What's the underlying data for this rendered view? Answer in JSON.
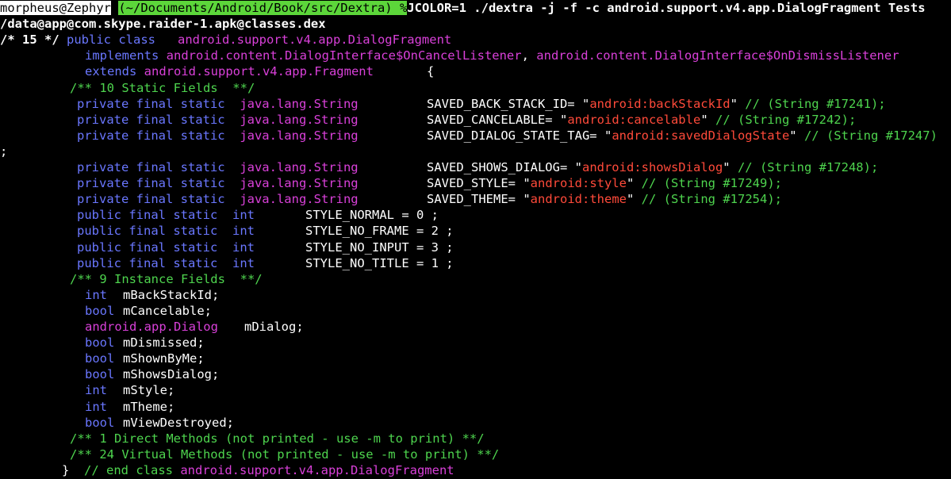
{
  "prompt": {
    "user": "morpheus@Zephyr",
    "cwd": "(~/Documents/Android/Book/src/Dextra)",
    "symbol": "%",
    "command": "JCOLOR=1 ./dextra -j -f -c android.support.v4.app.DialogFragment Tests"
  },
  "dex_path": "/data@app@com.skype.raider-1.apk@classes.dex",
  "class_decl": {
    "index_comment": "/* 15 */",
    "modifiers": "public class",
    "name": "android.support.v4.app.DialogFragment",
    "implements_kw": "implements",
    "interface1": "android.content.DialogInterface$OnCancelListener",
    "comma": ",",
    "interface2": "android.content.DialogInterface$OnDismissListener",
    "extends_kw": "extends",
    "superclass": "android.support.v4.app.Fragment",
    "open_brace": "{"
  },
  "static_fields_header": "/** 10 Static Fields  **/",
  "static_string_fields": [
    {
      "modifiers": "private final static",
      "type": "java.lang.String",
      "name": "SAVED_BACK_STACK_ID= ",
      "q1": "\"",
      "value": "android:backStackId",
      "q2": "\"",
      "comment": " // (String #17241);"
    },
    {
      "modifiers": "private final static",
      "type": "java.lang.String",
      "name": "SAVED_CANCELABLE= ",
      "q1": "\"",
      "value": "android:cancelable",
      "q2": "\"",
      "comment": " // (String #17242);"
    },
    {
      "modifiers": "private final static",
      "type": "java.lang.String",
      "name": "SAVED_DIALOG_STATE_TAG= ",
      "q1": "\"",
      "value": "android:savedDialogState",
      "q2": "\"",
      "comment": " // (String #17247)"
    },
    {
      "modifiers": "private final static",
      "type": "java.lang.String",
      "name": "SAVED_SHOWS_DIALOG= ",
      "q1": "\"",
      "value": "android:showsDialog",
      "q2": "\"",
      "comment": " // (String #17248);"
    },
    {
      "modifiers": "private final static",
      "type": "java.lang.String",
      "name": "SAVED_STYLE= ",
      "q1": "\"",
      "value": "android:style",
      "q2": "\"",
      "comment": " // (String #17249);"
    },
    {
      "modifiers": "private final static",
      "type": "java.lang.String",
      "name": "SAVED_THEME= ",
      "q1": "\"",
      "value": "android:theme",
      "q2": "\"",
      "comment": " // (String #17254);"
    }
  ],
  "wrap_semicolon": ";",
  "static_int_fields": [
    {
      "modifiers": "public final static",
      "type": "int",
      "decl": "STYLE_NORMAL = 0 ;"
    },
    {
      "modifiers": "public final static",
      "type": "int",
      "decl": "STYLE_NO_FRAME = 2 ;"
    },
    {
      "modifiers": "public final static",
      "type": "int",
      "decl": "STYLE_NO_INPUT = 3 ;"
    },
    {
      "modifiers": "public final static",
      "type": "int",
      "decl": "STYLE_NO_TITLE = 1 ;"
    }
  ],
  "instance_fields_header": "/** 9 Instance Fields  **/",
  "instance_fields": [
    {
      "type": "int",
      "name": "mBackStackId;"
    },
    {
      "type": "bool",
      "name": "mCancelable;"
    },
    {
      "type": "android.app.Dialog",
      "name": "mDialog;"
    },
    {
      "type": "bool",
      "name": "mDismissed;"
    },
    {
      "type": "bool",
      "name": "mShownByMe;"
    },
    {
      "type": "bool",
      "name": "mShowsDialog;"
    },
    {
      "type": "int",
      "name": "mStyle;"
    },
    {
      "type": "int",
      "name": "mTheme;"
    },
    {
      "type": "bool",
      "name": "mViewDestroyed;"
    }
  ],
  "direct_methods": "/** 1 Direct Methods (not printed - use -m to print) **/",
  "virtual_methods": "/** 24 Virtual Methods (not printed - use -m to print) **/",
  "end_class": {
    "brace": "}",
    "comment": "// end class",
    "name": "android.support.v4.app.DialogFragment"
  },
  "colors": {
    "background": "#000000",
    "keyword": "#6a77ff",
    "type": "#d940d9",
    "comment": "#4ed44e",
    "string": "#ff4a3a",
    "prompt_path_bg": "#5cd63a"
  }
}
